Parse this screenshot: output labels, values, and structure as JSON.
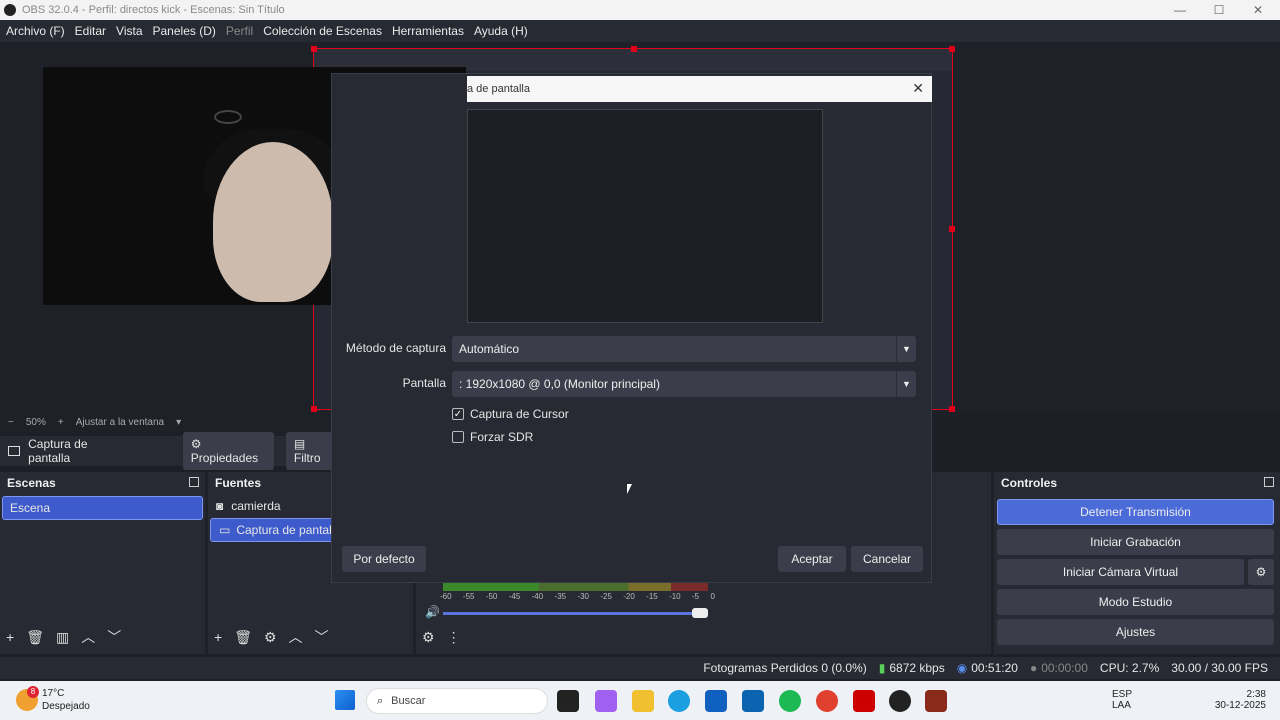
{
  "window": {
    "title": "OBS 32.0.4 - Perfil: directos kick - Escenas: Sin Título",
    "minimize": "—",
    "maximize": "☐",
    "close": "✕"
  },
  "menu": [
    "Archivo (F)",
    "Editar",
    "Vista",
    "Paneles (D)",
    "Perfil",
    "Colección de Escenas",
    "Herramientas",
    "Ayuda (H)"
  ],
  "zoom": {
    "minus": "−",
    "value": "50%",
    "plus": "+",
    "fit": "Ajustar a la ventana",
    "caret": "▾"
  },
  "source_bar": {
    "name": "Captura de pantalla",
    "properties": "Propiedades",
    "filters": "Filtro"
  },
  "scenes": {
    "title": "Escenas",
    "items": [
      "Escena"
    ]
  },
  "sources": {
    "title": "Fuentes",
    "items": [
      {
        "label": "camierda",
        "icon": "camera-icon"
      },
      {
        "label": "Captura de pantalla",
        "icon": "monitor-icon"
      }
    ]
  },
  "controls": {
    "title": "Controles",
    "buttons": [
      "Detener Transmisión",
      "Iniciar Grabación",
      "Iniciar Cámara Virtual",
      "Modo Estudio",
      "Ajustes"
    ]
  },
  "mixer": {
    "scale": [
      "-60",
      "-55",
      "-50",
      "-45",
      "-40",
      "-35",
      "-30",
      "-25",
      "-20",
      "-15",
      "-10",
      "-5",
      "0"
    ]
  },
  "status": {
    "dropped": "Fotogramas Perdidos 0 (0.0%)",
    "bitrate": "6872 kbps",
    "stream_time": "00:51:20",
    "rec_time": "00:00:00",
    "cpu": "CPU: 2.7%",
    "fps": "30.00 / 30.00 FPS"
  },
  "dialog": {
    "title": "a de pantalla",
    "method_label": "Método de captura",
    "method_value": "Automático",
    "screen_label": "Pantalla",
    "screen_value": ": 1920x1080 @ 0,0 (Monitor principal)",
    "cursor_label": "Captura de Cursor",
    "cursor_checked": true,
    "sdr_label": "Forzar SDR",
    "sdr_checked": false,
    "defaults": "Por defecto",
    "accept": "Aceptar",
    "cancel": "Cancelar"
  },
  "taskbar": {
    "weather_temp": "17°C",
    "weather_desc": "Despejado",
    "weather_badge": "8",
    "search": "Buscar",
    "lang1": "ESP",
    "lang2": "LAA",
    "time": "2:38",
    "date": "30-12-2025"
  }
}
